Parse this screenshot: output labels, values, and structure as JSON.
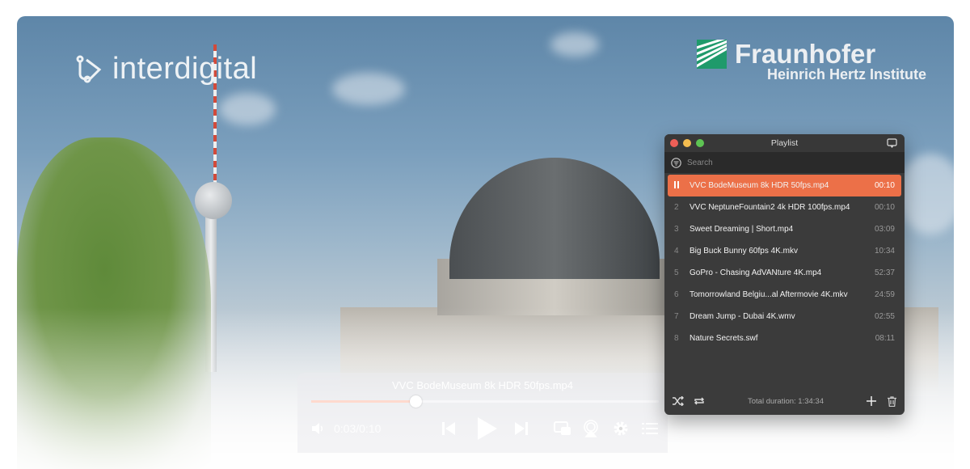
{
  "logos": {
    "left": "interdigital",
    "right_name": "Fraunhofer",
    "right_sub": "Heinrich Hertz Institute"
  },
  "player": {
    "now_playing": "VVC BodeMuseum 8k HDR 50fps.mp4",
    "time": "0:03/0:10",
    "progress": 0.3,
    "icons": [
      "volume-icon",
      "previous-icon",
      "play-icon",
      "next-icon",
      "picture-in-picture-icon",
      "airplay-icon",
      "settings-icon",
      "playlist-icon"
    ]
  },
  "playlist": {
    "title": "Playlist",
    "search_placeholder": "Search",
    "accent": "#ec7048",
    "items": [
      {
        "index": "",
        "title": "VVC BodeMuseum 8k HDR 50fps.mp4",
        "duration": "00:10",
        "playing": true
      },
      {
        "index": "2",
        "title": "VVC NeptuneFountain2 4k HDR 100fps.mp4",
        "duration": "00:10"
      },
      {
        "index": "3",
        "title": "Sweet Dreaming | Short.mp4",
        "duration": "03:09"
      },
      {
        "index": "4",
        "title": "Big Buck Bunny 60fps 4K.mkv",
        "duration": "10:34"
      },
      {
        "index": "5",
        "title": "GoPro - Chasing AdVANture 4K.mp4",
        "duration": "52:37"
      },
      {
        "index": "6",
        "title": "Tomorrowland Belgiu...al Aftermovie 4K.mkv",
        "duration": "24:59"
      },
      {
        "index": "7",
        "title": "Dream Jump - Dubai 4K.wmv",
        "duration": "02:55"
      },
      {
        "index": "8",
        "title": "Nature Secrets.swf",
        "duration": "08:11"
      }
    ],
    "total_duration": "Total duration: 1:34:34"
  }
}
